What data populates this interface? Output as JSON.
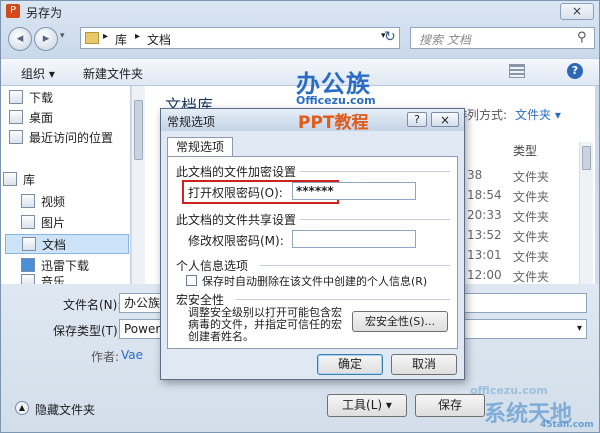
{
  "window": {
    "title": "另存为",
    "close_glyph": "×"
  },
  "nav": {
    "breadcrumb": [
      "库",
      "文档"
    ],
    "separator": "▸",
    "refresh_glyph": "↻",
    "search_placeholder": "搜索 文档",
    "search_glyph": "⚲"
  },
  "toolbar": {
    "organize": "组织 ▾",
    "new_folder": "新建文件夹",
    "help_glyph": "?"
  },
  "sidebar": {
    "items": [
      "下载",
      "桌面",
      "最近访问的位置",
      "库",
      "视频",
      "图片",
      "文档",
      "迅雷下载",
      "音乐"
    ]
  },
  "content": {
    "library_title": "文档库",
    "sort_label": "排列方式:",
    "sort_value": "文件夹 ▾",
    "type_header": "类型",
    "rows": [
      {
        "time": "38",
        "type": "文件夹"
      },
      {
        "time": "18:54",
        "type": "文件夹"
      },
      {
        "time": "20:33",
        "type": "文件夹"
      },
      {
        "time": "13:52",
        "type": "文件夹"
      },
      {
        "time": "13:01",
        "type": "文件夹"
      },
      {
        "time": "12:00",
        "type": "文件夹"
      }
    ]
  },
  "form": {
    "filename_label": "文件名(N):",
    "filename_value": "办公族",
    "savetype_label": "保存类型(T):",
    "savetype_value": "PowerPoint",
    "author_label": "作者:",
    "author_value": "Vae",
    "hide_folders": "隐藏文件夹",
    "tools_button": "工具(L) ▾",
    "save_button": "保存"
  },
  "dialog": {
    "title": "常规选项",
    "help_glyph": "?",
    "close_glyph": "×",
    "tab": "常规选项",
    "sec_encrypt": "此文档的文件加密设置",
    "open_pw_label": "打开权限密码(O):",
    "open_pw_value": "******",
    "sec_share": "此文档的文件共享设置",
    "modify_pw_label": "修改权限密码(M):",
    "modify_pw_value": "",
    "sec_privacy": "个人信息选项",
    "privacy_checkbox": "保存时自动删除在该文件中创建的个人信息(R)",
    "sec_macro": "宏安全性",
    "macro_text": "调整安全级别以打开可能包含宏病毒的文件，并指定可信任的宏创建者姓名。",
    "macro_button": "宏安全性(S)...",
    "ok_button": "确定",
    "cancel_button": "取消"
  },
  "watermarks": {
    "logo_top": "办公族",
    "logo_sub": "Officezu.com",
    "ppt": "PPT教程",
    "bottom_url": "officezu.com",
    "bottom_logo": "系统天地",
    "bottom_sub": "45tan.com"
  },
  "colors": {
    "highlight": "#cc2222",
    "accent_blue": "#2a6cc4",
    "watermark_orange": "#e05a1a"
  }
}
